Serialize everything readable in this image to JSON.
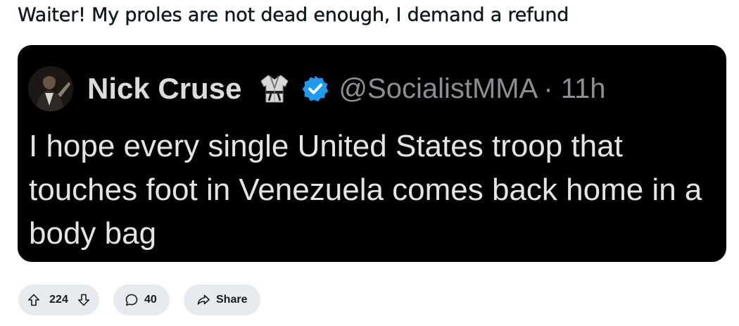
{
  "post": {
    "title": "Waiter! My proles are not dead enough, I demand a refund"
  },
  "tweet": {
    "author_name": "Nick Cruse",
    "handle": "@SocialistMMA",
    "time": "· 11h",
    "text": "I hope every single United States troop that touches foot in Venezuela comes back home in a body bag",
    "icons": {
      "avatar": "avatar",
      "emoji": "martial-arts-uniform-icon",
      "badge": "verified-badge-icon"
    },
    "colors": {
      "background": "#000000",
      "name": "#dcdcdc",
      "handle": "#8b8f93",
      "body": "#e4e4e4",
      "verified": "#1d9bf0"
    }
  },
  "actions": {
    "upvotes": "224",
    "comments": "40",
    "share_label": "Share",
    "pill_color": "#e5ebee"
  }
}
